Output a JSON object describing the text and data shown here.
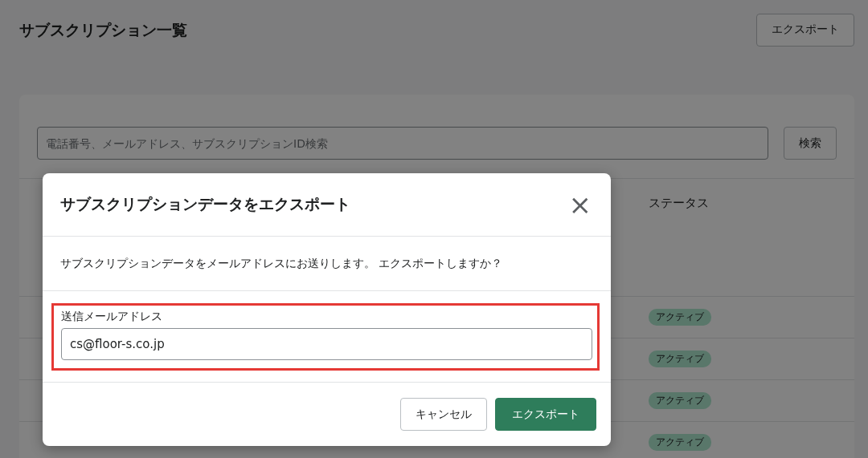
{
  "page": {
    "title": "サブスクリプション一覧",
    "export_button": "エクスポート"
  },
  "search": {
    "placeholder": "電話番号、メールアドレス、サブスクリプションID検索",
    "button": "検索"
  },
  "table": {
    "columns": [
      {
        "label": "ステータス"
      }
    ],
    "rows": [
      {
        "status": "アクティブ"
      },
      {
        "status": "アクティブ"
      },
      {
        "status": "アクティブ"
      },
      {
        "status": "アクティブ"
      }
    ]
  },
  "dialog": {
    "title": "サブスクリプションデータをエクスポート",
    "close": "×",
    "message": "サブスクリプションデータをメールアドレスにお送りします。 エクスポートしますか？",
    "field": {
      "label": "送信メールアドレス",
      "value": "cs@floor-s.co.jp",
      "highlighted": true
    },
    "buttons": [
      {
        "label": "キャンセル",
        "kind": "secondary"
      },
      {
        "label": "エクスポート",
        "kind": "primary"
      }
    ]
  }
}
